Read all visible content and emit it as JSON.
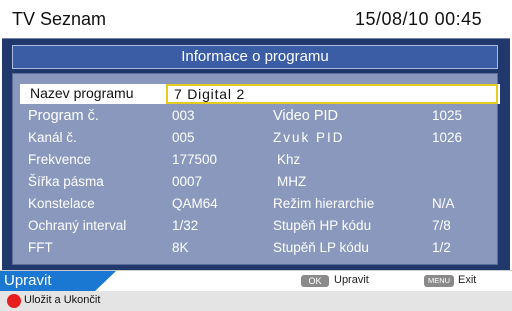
{
  "header": {
    "title": "TV Seznam",
    "datetime": "15/08/10  00:45"
  },
  "section_title": "Informace o programu",
  "name_row": {
    "label": "Nazev programu",
    "value": "7 Digital 2"
  },
  "rows": [
    {
      "l1": "Program č.",
      "v1": "003",
      "l2": "Video PID",
      "v2": "1025"
    },
    {
      "l1": "Kanál č.",
      "v1": "005",
      "l2": "Zvuk PID",
      "v2": "1026"
    },
    {
      "l1": "Frekvence",
      "v1": "177500",
      "l2": "Khz",
      "v2": ""
    },
    {
      "l1": "Šířka pásma",
      "v1": "0007",
      "l2": "MHZ",
      "v2": ""
    },
    {
      "l1": "Konstelace",
      "v1": "QAM64",
      "l2": "Režim hierarchie",
      "v2": "N/A"
    },
    {
      "l1": "Ochraný interval",
      "v1": "1/32",
      "l2": "Stupěň HP kódu",
      "v2": "7/8"
    },
    {
      "l1": "FFT",
      "v1": "8K",
      "l2": "Stupěň LP kódu",
      "v2": "1/2"
    }
  ],
  "footer": {
    "tab": "Upravit",
    "ok_key": "OK",
    "ok_label": "Upravit",
    "menu_key": "MENU",
    "menu_label": "Exit",
    "save_label": "Uložit a Ukončit"
  }
}
